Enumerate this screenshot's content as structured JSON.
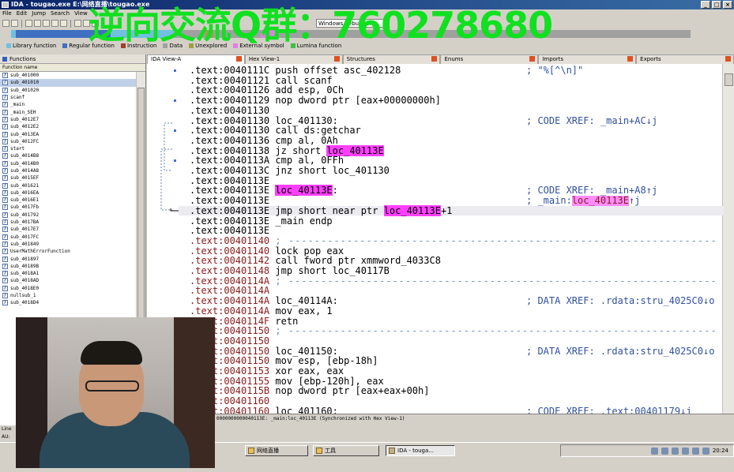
{
  "window": {
    "title": "IDA - tougao.exe E:\\网络直播\\tougao.exe",
    "controls": [
      "_",
      "□",
      "×"
    ]
  },
  "menu": [
    "File",
    "Edit",
    "Jump",
    "Search",
    "View"
  ],
  "toolbar": {
    "debugger_select": "Windows debugger"
  },
  "overlay": {
    "text": "逆向交流Q群：760278680",
    "color": "#10e020"
  },
  "legend": [
    {
      "label": "Library function",
      "color": "#70c0e0"
    },
    {
      "label": "Regular function",
      "color": "#4070c0"
    },
    {
      "label": "Instruction",
      "color": "#a04030"
    },
    {
      "label": "Data",
      "color": "#a0a0a0"
    },
    {
      "label": "Unexplored",
      "color": "#a0a040"
    },
    {
      "label": "External symbol",
      "color": "#e080e0"
    },
    {
      "label": "Lumina function",
      "color": "#40c040"
    }
  ],
  "tabs": [
    {
      "label": "IDA View-A",
      "active": true
    },
    {
      "label": "Hex View-1",
      "active": false
    },
    {
      "label": "Structures",
      "active": false
    },
    {
      "label": "Enums",
      "active": false
    },
    {
      "label": "Imports",
      "active": false
    },
    {
      "label": "Exports",
      "active": false
    }
  ],
  "functions_panel": {
    "title": "Functions",
    "column": "Function name",
    "items": [
      "sub_401000",
      "sub_401010",
      "sub_401020",
      "scanf",
      "_main",
      "_main_SEH",
      "sub_4012E7",
      "sub_4012E2",
      "sub_4013EA",
      "sub_4012FC",
      "start",
      "sub_4014B8",
      "sub_4014B0",
      "sub_4014A8",
      "sub_4015EF",
      "sub_401621",
      "sub_4016EA",
      "sub_4016E1",
      "sub_4017Fb",
      "sub_401792",
      "sub_4017BA",
      "sub_4017E7",
      "sub_4017FC",
      "sub_401849",
      "UserMathErrorFunction",
      "sub_401897",
      "sub_40189B",
      "sub_4018A1",
      "sub_4018AD",
      "sub_4018E0",
      "nullsub_1",
      "sub_4018D4"
    ],
    "selected_index": 1
  },
  "disassembly": [
    {
      "addr": ".text:0040111C",
      "label": "",
      "mnem": "push",
      "ops": "offset asc_402128",
      "comment": "; \"%[^\\n]\""
    },
    {
      "addr": ".text:00401121",
      "label": "",
      "mnem": "call",
      "ops": "scanf",
      "comment": ""
    },
    {
      "addr": ".text:00401126",
      "label": "",
      "mnem": "add",
      "ops": "esp, 0Ch",
      "comment": ""
    },
    {
      "addr": ".text:00401129",
      "label": "",
      "mnem": "nop",
      "ops": "dword ptr [eax+00000000h]",
      "comment": ""
    },
    {
      "addr": ".text:00401130",
      "label": "",
      "mnem": "",
      "ops": "",
      "comment": ""
    },
    {
      "addr": ".text:00401130",
      "label": "loc_401130:",
      "mnem": "",
      "ops": "",
      "comment": "; CODE XREF: _main+AC↓j"
    },
    {
      "addr": ".text:00401130",
      "label": "",
      "mnem": "call",
      "ops": "ds:getchar",
      "comment": ""
    },
    {
      "addr": ".text:00401136",
      "label": "",
      "mnem": "cmp",
      "ops": "al, 0Ah",
      "comment": ""
    },
    {
      "addr": ".text:00401138",
      "label": "",
      "mnem": "jz",
      "ops": "short ",
      "opsPink": "loc_40113E",
      "comment": ""
    },
    {
      "addr": ".text:0040113A",
      "label": "",
      "mnem": "cmp",
      "ops": "al, 0FFh",
      "comment": ""
    },
    {
      "addr": ".text:0040113C",
      "label": "",
      "mnem": "jnz",
      "ops": "short loc_401130",
      "comment": ""
    },
    {
      "addr": ".text:0040113E",
      "label": "",
      "mnem": "",
      "ops": "",
      "comment": ""
    },
    {
      "addr": ".text:0040113E",
      "labelPink": "loc_40113E",
      "label": ":",
      "mnem": "",
      "ops": "",
      "comment": "; CODE XREF: _main+A8↑j"
    },
    {
      "addr": ".text:0040113E",
      "label": "",
      "mnem": "",
      "ops": "",
      "comment": "; _main:",
      "commentPink": "loc_40113E",
      "commentTail": "↑j"
    },
    {
      "addr": ".text:0040113E",
      "label": "",
      "mnem": "jmp",
      "ops": "short near ptr ",
      "opsPink": "loc_40113E",
      "opsTail": "+1",
      "comment": "",
      "hl": true
    },
    {
      "addr": ".text:0040113E",
      "label": "_main",
      "mnem": "endp",
      "ops": "",
      "comment": ""
    },
    {
      "addr": ".text:0040113E",
      "label": "",
      "mnem": "",
      "ops": "",
      "comment": ""
    },
    {
      "addr": ".text:00401140",
      "label": "",
      "mnem": "",
      "ops": "",
      "comment": "",
      "dash": true,
      "red": true
    },
    {
      "addr": ".text:00401140",
      "label": "",
      "mnem": "lock pop eax",
      "ops": "",
      "comment": "",
      "red": true
    },
    {
      "addr": ".text:00401142",
      "label": "",
      "mnem": "call",
      "ops": "fword ptr xmmword_4033C8",
      "comment": "",
      "red": true
    },
    {
      "addr": ".text:00401148",
      "label": "",
      "mnem": "jmp",
      "ops": "short loc_40117B",
      "comment": "",
      "red": true
    },
    {
      "addr": ".text:0040114A",
      "label": "",
      "mnem": "",
      "ops": "",
      "comment": "",
      "dash": true,
      "red": true
    },
    {
      "addr": ".text:0040114A",
      "label": "",
      "mnem": "",
      "ops": "",
      "comment": "",
      "red": true
    },
    {
      "addr": ".text:0040114A",
      "label": "loc_40114A:",
      "mnem": "",
      "ops": "",
      "comment": "; DATA XREF: .rdata:stru_4025C0↓o",
      "red": true
    },
    {
      "addr": ".text:0040114A",
      "label": "",
      "mnem": "mov",
      "ops": "eax, 1",
      "comment": "",
      "red": true
    },
    {
      "addr": ".text:0040114F",
      "label": "",
      "mnem": "retn",
      "ops": "",
      "comment": "",
      "red": true
    },
    {
      "addr": ".text:00401150",
      "label": "",
      "mnem": "",
      "ops": "",
      "comment": "",
      "dash": true,
      "red": true
    },
    {
      "addr": ".text:00401150",
      "label": "",
      "mnem": "",
      "ops": "",
      "comment": "",
      "red": true
    },
    {
      "addr": ".text:00401150",
      "label": "loc_401150:",
      "mnem": "",
      "ops": "",
      "comment": "; DATA XREF: .rdata:stru_4025C0↓o",
      "red": true
    },
    {
      "addr": ".text:00401150",
      "label": "",
      "mnem": "mov",
      "ops": "esp, [ebp-18h]",
      "comment": "",
      "red": true
    },
    {
      "addr": ".text:00401153",
      "label": "",
      "mnem": "xor",
      "ops": "eax, eax",
      "comment": "",
      "red": true
    },
    {
      "addr": ".text:00401155",
      "label": "",
      "mnem": "mov",
      "ops": "[ebp-120h], eax",
      "comment": "",
      "red": true
    },
    {
      "addr": ".text:0040115B",
      "label": "",
      "mnem": "nop",
      "ops": "dword ptr [eax+eax+00h]",
      "comment": "",
      "red": true
    },
    {
      "addr": ".text:00401160",
      "label": "",
      "mnem": "",
      "ops": "",
      "comment": "",
      "red": true
    },
    {
      "addr": ".text:00401160",
      "label": "loc_401160:",
      "mnem": "",
      "ops": "",
      "comment": "; CODE XREF: .text:00401179↓j",
      "red": true
    }
  ],
  "status_bar": "0000000000040113E: _main:loc_40113E (Synchronized with Hex View-1)",
  "bottom_left": [
    "Line",
    "AU:"
  ],
  "taskbar": {
    "buttons": [
      {
        "label": "网络直播",
        "active": false
      },
      {
        "label": "工具",
        "active": false
      },
      {
        "label": "IDA - touga...",
        "active": true
      }
    ],
    "clock": "20:24"
  }
}
